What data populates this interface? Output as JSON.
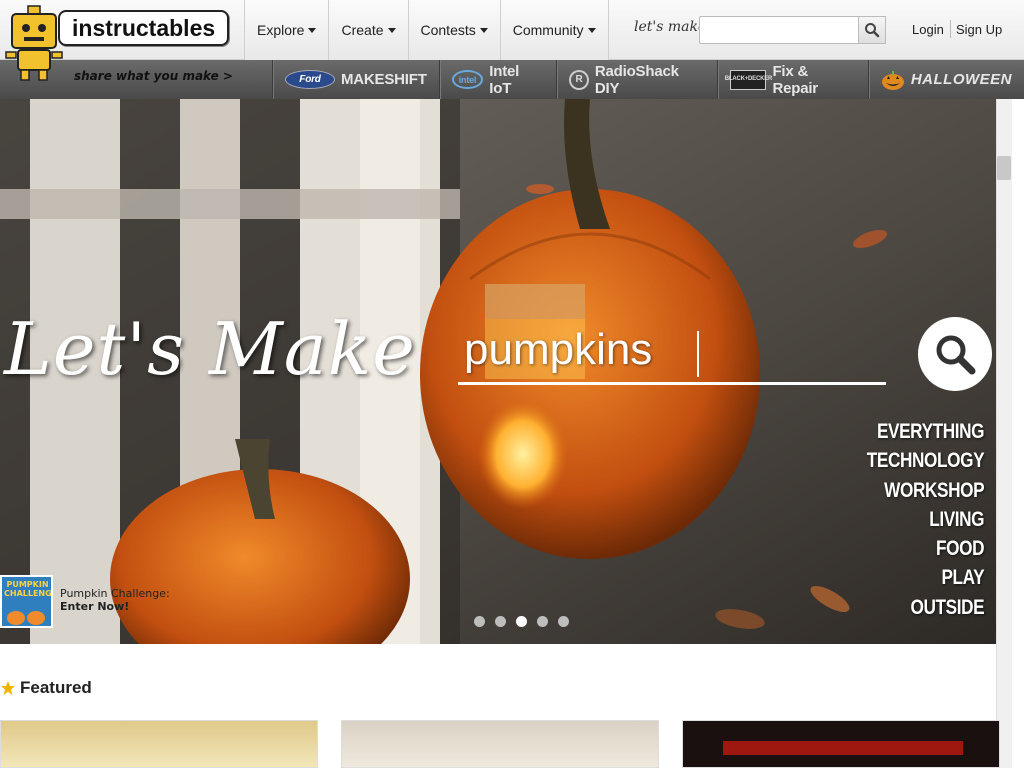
{
  "header": {
    "logo_text": "instructables",
    "tagline": "share what you make >",
    "nav": [
      {
        "label": "Explore"
      },
      {
        "label": "Create"
      },
      {
        "label": "Contests"
      },
      {
        "label": "Community"
      }
    ],
    "search_label": "let's make",
    "search_placeholder": "",
    "login_label": "Login",
    "signup_label": "Sign Up"
  },
  "sponsors": [
    {
      "logo": "Ford",
      "label": "MAKESHIFT"
    },
    {
      "logo": "intel",
      "label": "Intel IoT"
    },
    {
      "logo": "R",
      "label": "RadioShack DIY"
    },
    {
      "logo": "BLACK+DECKER",
      "label": "Fix & Repair"
    },
    {
      "logo": "",
      "label": "HALLOWEEN"
    }
  ],
  "hero": {
    "title": "Let's Make",
    "search_value": "pumpkins",
    "categories": [
      "EVERYTHING",
      "TECHNOLOGY",
      "WORKSHOP",
      "LIVING",
      "FOOD",
      "PLAY",
      "OUTSIDE"
    ],
    "promo_thumb_label": "PUMPKIN CHALLENGE",
    "promo_line1": "Pumpkin Challenge:",
    "promo_line2": "Enter Now!",
    "slide_count": 5,
    "active_slide": 3
  },
  "featured": {
    "title": "Featured"
  },
  "colors": {
    "pumpkin": "#d9651a",
    "accent_star": "#f0b400"
  }
}
